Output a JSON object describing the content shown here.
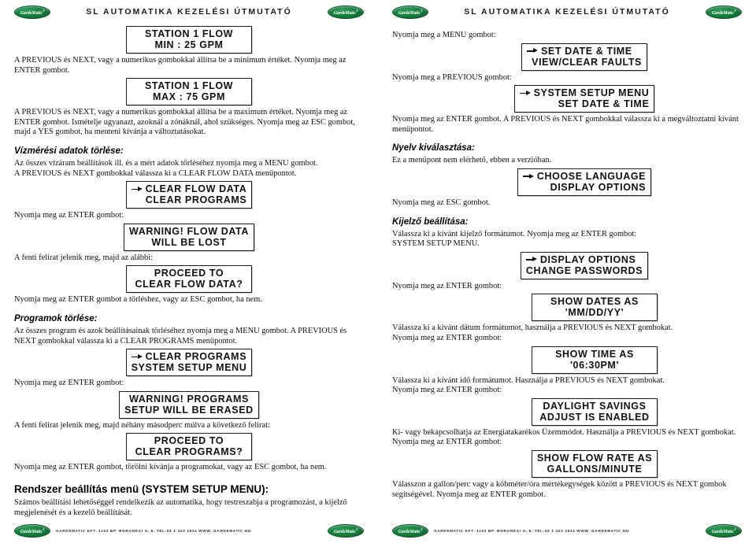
{
  "header": {
    "title": "SL AUTOMATIKA KEZELÉSI ÚTMUTATÓ",
    "logo_text": "GardeMatic",
    "logo_mark": "®"
  },
  "footer": {
    "text": "GARDEMATIC KFT. 1163 BP. BORONKAI U. 8. TEL:06 1 403 2634 WWW. GARDEMATIC.HU"
  },
  "left_page": {
    "lcd_station_min": {
      "line1": "STATION 1 FLOW",
      "line2": "MIN : 25 GPM"
    },
    "para_min": "A PREVIOUS és NEXT, vagy a numerikus gombokkal állítsa be a minimum értéket. Nyomja meg az ENTER gombot.",
    "lcd_station_max": {
      "line1": "STATION 1 FLOW",
      "line2": "MAX : 75 GPM"
    },
    "para_max": "A PREVIOUS és NEXT, vagy a numerikus gombokkal állítsa be a maximum értéket. Nyomja meg az ENTER gombot. Ismételje ugyanazt, azoknál a zónáknál, ahol szükséges. Nyomja meg az ESC gombot, majd a YES gombot, ha menteni kívánja a változtatásokat.",
    "heading_flowclear": "Vízmérési adatok törlése:",
    "para_flowclear_1": "Az összes vízáram beállítások ill. és a mért adatok törléséhez nyomja meg a MENU gombot.",
    "para_flowclear_2": "A PREVIOUS és NEXT gombokkal válassza ki a CLEAR FLOW DATA menüpontot.",
    "lcd_clear_flow_menu": {
      "line1": "CLEAR FLOW DATA",
      "line2": "CLEAR PROGRAMS"
    },
    "para_enter_1": "Nyomja meg az ENTER gombot:",
    "lcd_warning_flow": {
      "line1": "WARNING! FLOW DATA",
      "line2": "WILL BE LOST"
    },
    "para_fenti_1": "A fenti felirat jelenik meg, majd az alábbi:",
    "lcd_proceed_flow": {
      "line1": "PROCEED TO",
      "line2": "CLEAR FLOW DATA?"
    },
    "para_confirm_flow": "Nyomja meg az ENTER gombot a törléshez, vagy az ESC gombot, ha nem.",
    "heading_progclear": "Programok törlése:",
    "para_progclear_1": "Az összes program és azok beállításainak törléséhez nyomja meg a MENU gombot. A PREVIOUS és NEXT gombokkal válassza ki a CLEAR PROGRAMS menüpontot.",
    "lcd_clear_prog_menu": {
      "line1": "CLEAR PROGRAMS",
      "line2": "SYSTEM SETUP MENU"
    },
    "para_enter_2": "Nyomja meg az ENTER gombot:",
    "lcd_warning_prog": {
      "line1": "WARNING! PROGRAMS",
      "line2": "SETUP WILL BE ERASED"
    },
    "para_fenti_2": "A fenti felirat jelenik meg, majd néhány másodperc múlva a következő felirat:",
    "lcd_proceed_prog": {
      "line1": "PROCEED TO",
      "line2": "CLEAR PROGRAMS?"
    },
    "para_confirm_prog": "Nyomja meg az ENTER gombot, törölni kívánja a programokat, vagy az ESC gombot, ha nem.",
    "heading_system": "Rendszer beállítás menü (SYSTEM SETUP MENU):",
    "para_system": "Számos beállítási lehetőséggel rendelkezik az automatika, hogy testreszabja a programozást, a kijelző megjelenését és a kezelő beállítását."
  },
  "right_page": {
    "para_menu": "Nyomja meg a MENU gombot:",
    "lcd_setdate": {
      "line1": "SET DATE & TIME",
      "line2": "VIEW/CLEAR FAULTS"
    },
    "para_previous": "Nyomja meg a PREVIOUS gombot:",
    "lcd_systemsetup": {
      "line1": "SYSTEM SETUP MENU",
      "line2": "SET DATE & TIME"
    },
    "para_enter_select": "Nyomja meg az ENTER gombot. A PREVIOUS és NEXT gombokkal válassza ki a megváltoztatni kívánt menüpontot.",
    "heading_language": "Nyelv kiválasztása:",
    "para_language": "Ez a menüpont nem elérhető, ebben a verzióban.",
    "lcd_language": {
      "line1": "CHOOSE LANGUAGE",
      "line2": "DISPLAY OPTIONS"
    },
    "para_esc": "Nyomja meg az ESC gombot.",
    "heading_display": "Kijelző beállítása:",
    "para_display_1": "Válassza ki a kívánt kijelző formátumot. Nyomja meg az ENTER gombot:",
    "para_display_2": "SYSTEM SETUP MENU.",
    "lcd_display_opts": {
      "line1": "DISPLAY OPTIONS",
      "line2": "CHANGE PASSWORDS"
    },
    "para_enter_3": "Nyomja meg az ENTER gombot:",
    "lcd_showdates": {
      "line1": "SHOW DATES AS",
      "line2": "'MM/DD/YY'"
    },
    "para_dateformat_1": "Válassza ki a kívánt dátum formátumot, használja a PREVIOUS és NEXT gombokat.",
    "para_dateformat_2": "Nyomja meg az ENTER gombot:",
    "lcd_showtime": {
      "line1": "SHOW TIME AS",
      "line2": "'06:30PM'"
    },
    "para_timeformat_1": "Válassza ki a kívánt idő formátumot. Használja a PREVIOUS és NEXT gombokat.",
    "para_timeformat_2": "Nyomja meg az ENTER gombot:",
    "lcd_daylight": {
      "line1": "DAYLIGHT SAVINGS",
      "line2": "ADJUST IS ENABLED"
    },
    "para_daylight": "Ki- vagy bekapcsolhatja az Energiatakarékos Üzemmódot. Használja a PREVIOUS és NEXT gombokat. Nyomja meg az ENTER gombot:",
    "lcd_flowrate": {
      "line1": "SHOW FLOW RATE AS",
      "line2": "GALLONS/MINUTE"
    },
    "para_flowrate": "Válasszon a gallon/perc vagy a köbméter/óra mértékegységek között a PREVIOUS és NEXT gombok segítségével. Nyomja meg az ENTER gombot."
  }
}
